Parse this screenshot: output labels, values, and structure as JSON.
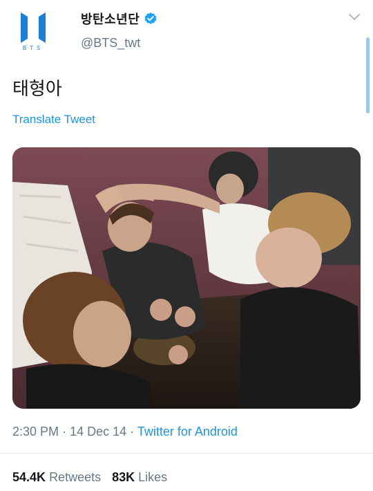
{
  "account": {
    "display_name": "방탄소년단",
    "handle": "@BTS_twt",
    "logo_text": "BTS"
  },
  "tweet": {
    "text": "태형아",
    "translate_label": "Translate Tweet",
    "time": "2:30 PM",
    "date": "14 Dec 14",
    "source": "Twitter for Android",
    "separator": "·"
  },
  "stats": {
    "retweets_count": "54.4K",
    "retweets_label": "Retweets",
    "likes_count": "83K",
    "likes_label": "Likes"
  },
  "icons": {
    "verified": "verified-badge-icon",
    "menu": "chevron-down-icon",
    "logo": "bts-logo-icon"
  },
  "colors": {
    "link": "#1b95e0",
    "secondary_text": "#657786",
    "logo_blue": "#1a7fd6",
    "verified": "#1da1f2"
  }
}
